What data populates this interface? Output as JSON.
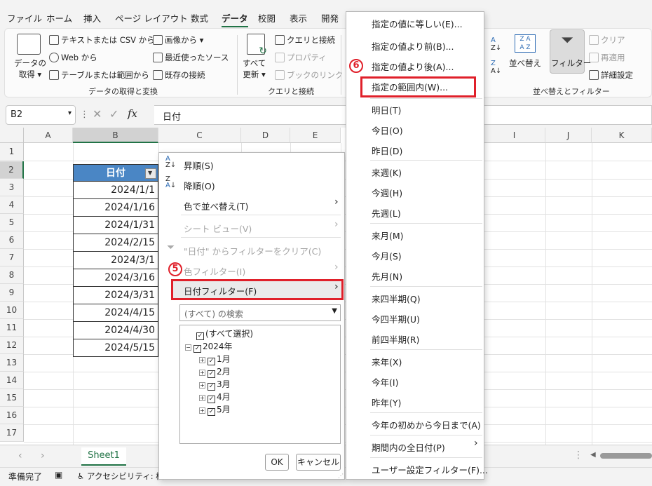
{
  "tabs": [
    "ファイル",
    "ホーム",
    "挿入",
    "ページ レイアウト",
    "数式",
    "データ",
    "校閲",
    "表示",
    "開発"
  ],
  "ribbon": {
    "get_data": "データの\n取得",
    "get_data_l1": "データの",
    "get_data_l2": "取得",
    "text_csv": "テキストまたは CSV から",
    "web": "Web から",
    "table_range": "テーブルまたは範囲から",
    "image_from": "画像から",
    "recent_sources": "最近使ったソース",
    "existing": "既存の接続",
    "group1": "データの取得と変換",
    "refresh_l1": "すべて",
    "refresh_l2": "更新",
    "queries": "クエリと接続",
    "properties": "プロパティ",
    "book_links": "ブックのリンク",
    "group2": "クエリと接続",
    "sort": "並べ替え",
    "filter": "フィルター",
    "clear": "クリア",
    "reapply": "再適用",
    "advanced": "詳細設定",
    "group3": "並べ替えとフィルター"
  },
  "formula_bar": {
    "name_box": "B2",
    "formula": "日付",
    "fx": "fx"
  },
  "columns": [
    "A",
    "B",
    "C",
    "D",
    "E",
    "I",
    "J",
    "K"
  ],
  "rows": [
    "1",
    "2",
    "3",
    "4",
    "5",
    "6",
    "7",
    "8",
    "9",
    "10",
    "11",
    "12",
    "13",
    "14",
    "15",
    "16",
    "17"
  ],
  "table": {
    "header": "日付",
    "values": [
      "2024/1/1",
      "2024/1/16",
      "2024/1/31",
      "2024/2/15",
      "2024/3/1",
      "2024/3/16",
      "2024/3/31",
      "2024/4/15",
      "2024/4/30",
      "2024/5/15"
    ]
  },
  "filter_menu": {
    "sort_asc": "昇順(S)",
    "sort_desc": "降順(O)",
    "sort_color": "色で並べ替え(T)",
    "sheet_view": "シート ビュー(V)",
    "clear_filter": "\"日付\" からフィルターをクリア(C)",
    "color_filter": "色フィルター(I)",
    "date_filter": "日付フィルター(F)",
    "search_placeholder": "(すべて) の検索",
    "tree": {
      "select_all": "(すべて選択)",
      "year": "2024年",
      "months": [
        "1月",
        "2月",
        "3月",
        "4月",
        "5月"
      ]
    },
    "ok": "OK",
    "cancel": "キャンセル",
    "step_label": "5"
  },
  "date_submenu": {
    "items": [
      "指定の値に等しい(E)...",
      "指定の値より前(B)...",
      "指定の値より後(A)...",
      "指定の範囲内(W)...",
      "明日(T)",
      "今日(O)",
      "昨日(D)",
      "来週(K)",
      "今週(H)",
      "先週(L)",
      "来月(M)",
      "今月(S)",
      "先月(N)",
      "来四半期(Q)",
      "今四半期(U)",
      "前四半期(R)",
      "来年(X)",
      "今年(I)",
      "昨年(Y)",
      "今年の初めから今日まで(A)",
      "期間内の全日付(P)",
      "ユーザー設定フィルター(F)..."
    ],
    "step_label": "6"
  },
  "sheet_tab": "Sheet1",
  "status": {
    "ready": "準備完了",
    "accessibility": "アクセシビリティ: 検"
  }
}
